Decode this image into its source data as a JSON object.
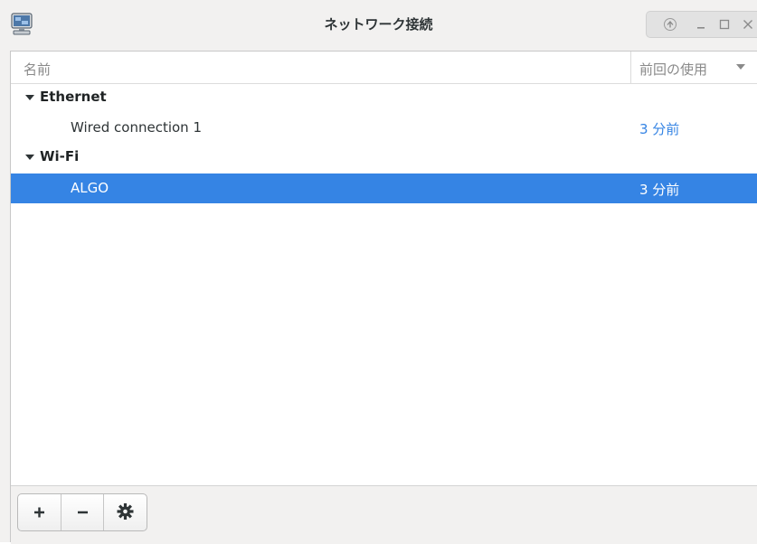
{
  "window": {
    "title": "ネットワーク接続"
  },
  "columns": {
    "name": "名前",
    "last_used": "前回の使用"
  },
  "groups": [
    {
      "label": "Ethernet",
      "connections": [
        {
          "name": "Wired connection 1",
          "last_used": "3 分前",
          "selected": false
        }
      ]
    },
    {
      "label": "Wi-Fi",
      "connections": [
        {
          "name": "ALGO",
          "last_used": "3 分前",
          "selected": true
        }
      ]
    }
  ],
  "toolbar": {
    "add_label": "+",
    "remove_label": "−",
    "settings_icon": "gear-icon"
  },
  "colors": {
    "selection": "#3584e4",
    "accent_text": "#3584e4"
  }
}
